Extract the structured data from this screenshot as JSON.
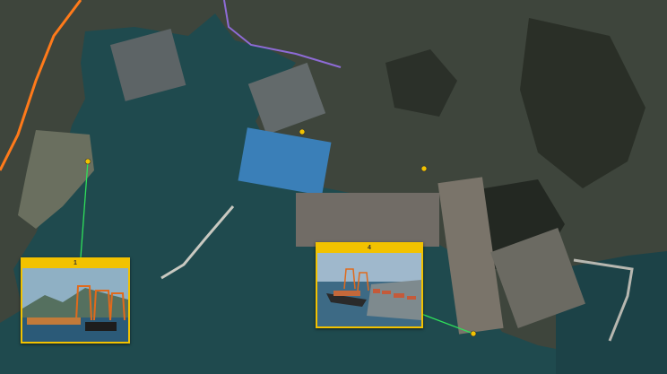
{
  "map": {
    "type": "satellite",
    "water_color": "#1f4a4e",
    "land_color": "#3f453c",
    "callout_color": "#f2c200",
    "leader_color": "#2fe05a"
  },
  "callouts": [
    {
      "number": "1",
      "label": "",
      "marker_icon": "pin-icon"
    },
    {
      "number": "4",
      "label": "",
      "marker_icon": "pin-icon"
    }
  ],
  "place_labels": [
    "",
    "",
    "",
    "",
    "",
    "",
    "",
    ""
  ]
}
